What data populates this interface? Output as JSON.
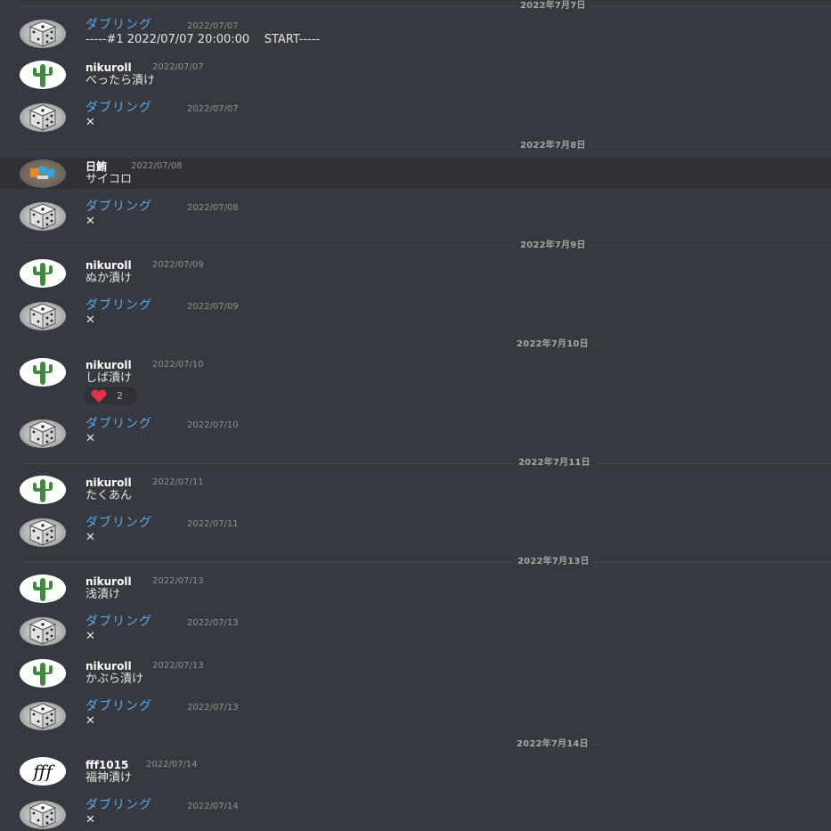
{
  "dates": [
    {
      "label": "2022年7月7日"
    },
    {
      "label": "2022年7月8日"
    },
    {
      "label": "2022年7月9日"
    },
    {
      "label": "2022年7月10日"
    },
    {
      "label": "2022年7月11日"
    },
    {
      "label": "2022年7月13日"
    },
    {
      "label": "2022年7月14日"
    }
  ],
  "messages": [
    {
      "author": "ダブリング",
      "timestamp": "2022/07/07",
      "content": "-----#1 2022/07/07 20:00:00    START-----",
      "avatar": "dice-avatar"
    },
    {
      "author": "nikuroll",
      "timestamp": "2022/07/07",
      "content": "べったら漬け",
      "avatar": "cactus-avatar"
    },
    {
      "author": "ダブリング",
      "timestamp": "2022/07/07",
      "content": "✕",
      "avatar": "dice-avatar"
    },
    {
      "author": "日鮪",
      "timestamp": "2022/07/08",
      "content": "サイコロ",
      "avatar": "fish-avatar"
    },
    {
      "author": "ダブリング",
      "timestamp": "2022/07/08",
      "content": "✕",
      "avatar": "dice-avatar"
    },
    {
      "author": "nikuroll",
      "timestamp": "2022/07/09",
      "content": "ぬか漬け",
      "avatar": "cactus-avatar"
    },
    {
      "author": "ダブリング",
      "timestamp": "2022/07/09",
      "content": "✕",
      "avatar": "dice-avatar"
    },
    {
      "author": "nikuroll",
      "timestamp": "2022/07/10",
      "content": "しば漬け",
      "avatar": "cactus-avatar",
      "reaction": {
        "emoji": "heart-icon",
        "count": "2"
      }
    },
    {
      "author": "ダブリング",
      "timestamp": "2022/07/10",
      "content": "✕",
      "avatar": "dice-avatar"
    },
    {
      "author": "nikuroll",
      "timestamp": "2022/07/11",
      "content": "たくあん",
      "avatar": "cactus-avatar"
    },
    {
      "author": "ダブリング",
      "timestamp": "2022/07/11",
      "content": "✕",
      "avatar": "dice-avatar"
    },
    {
      "author": "nikuroll",
      "timestamp": "2022/07/13",
      "content": "浅漬け",
      "avatar": "cactus-avatar"
    },
    {
      "author": "ダブリング",
      "timestamp": "2022/07/13",
      "content": "✕",
      "avatar": "dice-avatar"
    },
    {
      "author": "nikuroll",
      "timestamp": "2022/07/13",
      "content": "かぶら漬け",
      "avatar": "cactus-avatar"
    },
    {
      "author": "ダブリング",
      "timestamp": "2022/07/13",
      "content": "✕",
      "avatar": "dice-avatar"
    },
    {
      "author": "fff1015",
      "timestamp": "2022/07/14",
      "content": "福神漬け",
      "avatar": "fff-avatar"
    },
    {
      "author": "ダブリング",
      "timestamp": "2022/07/14",
      "content": "✕",
      "avatar": "dice-avatar"
    }
  ],
  "colors": {
    "background": "#36393f",
    "bot_name": "#5aa9e6",
    "heart": "#e0334a"
  }
}
